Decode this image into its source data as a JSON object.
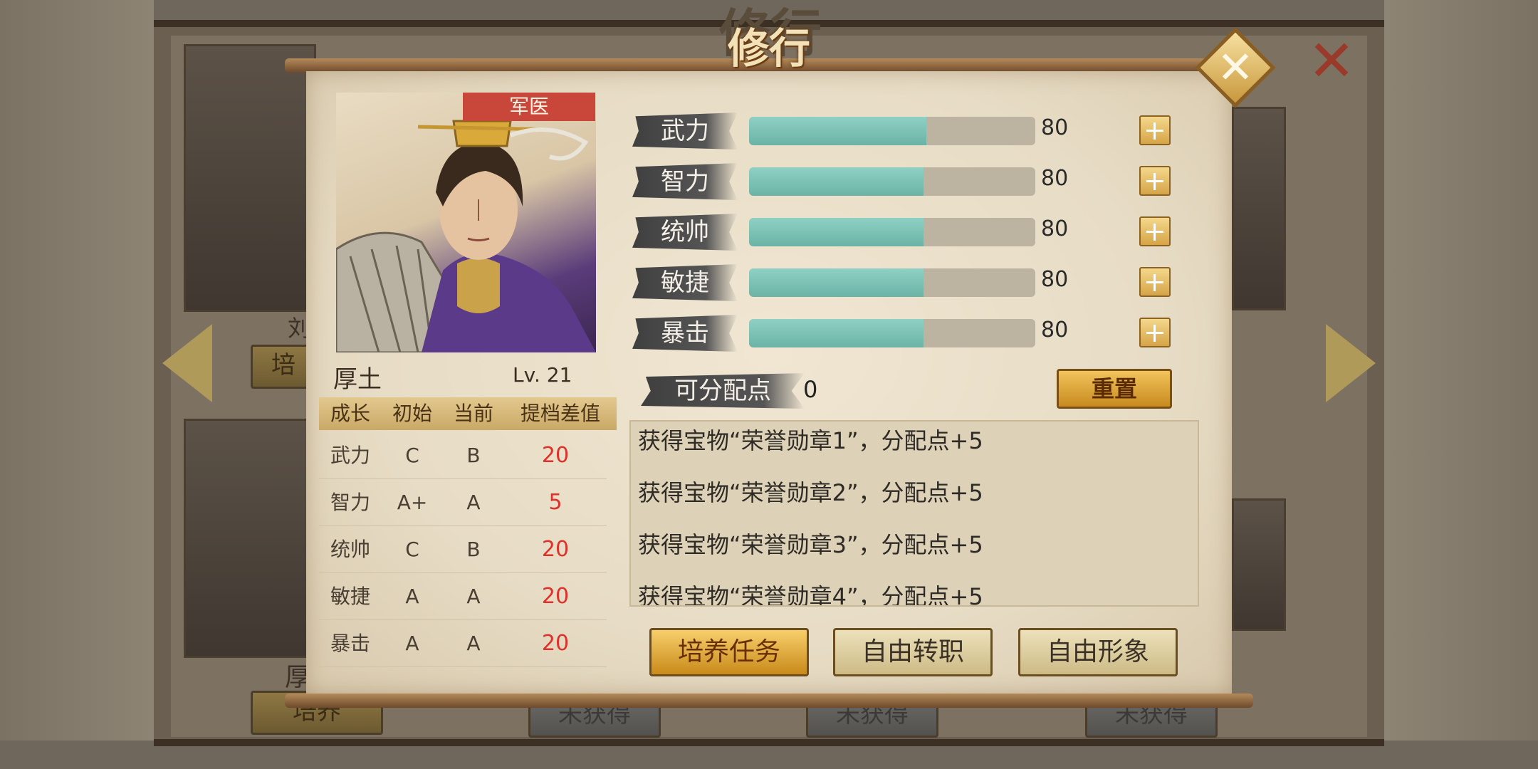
{
  "window": {
    "title": "修行"
  },
  "background": {
    "heroes": [
      {
        "name_partial": "刘",
        "button": "培"
      },
      {
        "name_partial": "厚",
        "button": "培养"
      }
    ],
    "locked_buttons": [
      "未获得",
      "未获得",
      "未获得"
    ]
  },
  "hero": {
    "class_badge": "军医",
    "name": "厚土",
    "level": "Lv. 21"
  },
  "growth_table": {
    "headers": [
      "成长",
      "初始",
      "当前",
      "提档差值"
    ],
    "rows": [
      {
        "stat": "武力",
        "initial": "C",
        "current": "B",
        "diff": "20"
      },
      {
        "stat": "智力",
        "initial": "A+",
        "current": "A",
        "diff": "5"
      },
      {
        "stat": "统帅",
        "initial": "C",
        "current": "B",
        "diff": "20"
      },
      {
        "stat": "敏捷",
        "initial": "A",
        "current": "A",
        "diff": "20"
      },
      {
        "stat": "暴击",
        "initial": "A",
        "current": "A",
        "diff": "20"
      }
    ]
  },
  "stats": [
    {
      "label": "武力",
      "value": "80",
      "fill": 0.62
    },
    {
      "label": "智力",
      "value": "80",
      "fill": 0.61
    },
    {
      "label": "统帅",
      "value": "80",
      "fill": 0.61
    },
    {
      "label": "敏捷",
      "value": "80",
      "fill": 0.61
    },
    {
      "label": "暴击",
      "value": "80",
      "fill": 0.61
    }
  ],
  "points": {
    "label": "可分配点",
    "value": "0"
  },
  "reset_label": "重置",
  "log": [
    "获得宝物“荣誉勋章1”，分配点+5",
    "获得宝物“荣誉勋章2”，分配点+5",
    "获得宝物“荣誉勋章3”，分配点+5",
    "获得宝物“荣誉勋章4”，分配点+5"
  ],
  "actions": {
    "train_task": "培养任务",
    "free_transfer": "自由转职",
    "free_image": "自由形象"
  },
  "colors": {
    "bar_fill": "#7cc2b6",
    "diff_red": "#e0302a",
    "badge_red": "#c8473a",
    "gold_button": "#e0aa40"
  },
  "icons": [
    "close-icon",
    "plus-icon",
    "arrow-left-icon",
    "arrow-right-icon"
  ]
}
